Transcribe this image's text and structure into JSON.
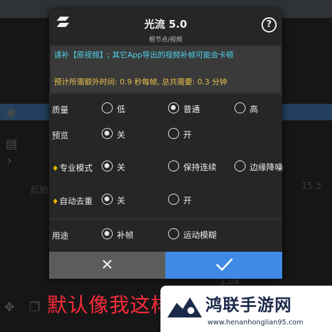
{
  "dialog": {
    "title": "光流 5.0",
    "subtitle": "根节点/视频",
    "help_icon": "?",
    "warning": "请补【原视频】; 其它App导出的视频补帧可能会卡顿",
    "estimate": "预计所需额外时间: 0.9 秒每帧, 总共需要: 0.3 分钟",
    "rows": [
      {
        "label": "质量",
        "options": [
          "低",
          "普通",
          "高"
        ],
        "selected": 1
      },
      {
        "label": "预览",
        "options": [
          "关",
          "开"
        ],
        "selected": 0
      },
      {
        "label": "专业模式",
        "premium": true,
        "options": [
          "关",
          "保持连续",
          "边缘降噪"
        ],
        "selected": 0
      },
      {
        "label": "自动去重",
        "premium": true,
        "options": [
          "关",
          "开"
        ],
        "selected": 0
      },
      {
        "label": "用途",
        "options": [
          "补帧",
          "运动模糊"
        ],
        "selected": 0
      }
    ],
    "cancel_glyph": "✕",
    "confirm_icon": "check-icon"
  },
  "background": {
    "caption": "默认像我这样",
    "partial_text": "起始",
    "side_value": "15.5",
    "speed_label": "1.0x"
  },
  "watermark": {
    "name": "鸿联手游网",
    "url": "www.henanhonglian95.com"
  },
  "colors": {
    "accent": "#3e8ae4",
    "warning_text": "#4fd3ee",
    "estimate_text": "#e8c04a",
    "caption": "#ff2b3a",
    "premium_gem": "#e8b400"
  }
}
